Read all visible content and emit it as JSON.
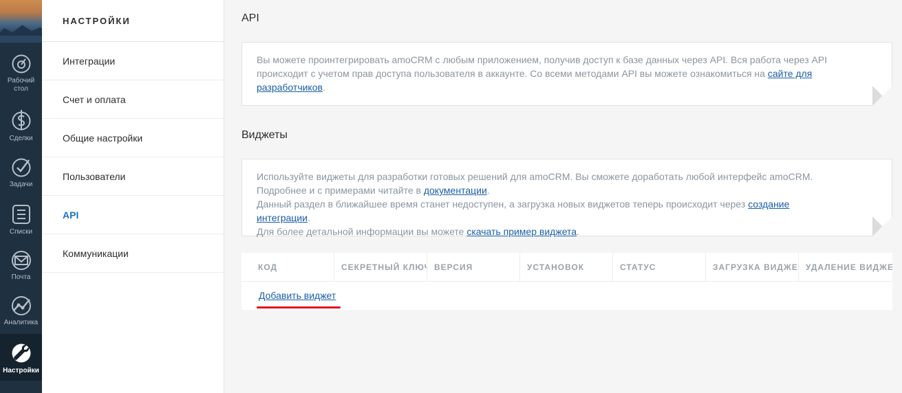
{
  "nav": {
    "items": [
      {
        "label": "Рабочий стол",
        "icon": "dashboard-icon"
      },
      {
        "label": "Сделки",
        "icon": "dollar-icon"
      },
      {
        "label": "Задачи",
        "icon": "check-icon"
      },
      {
        "label": "Списки",
        "icon": "list-icon"
      },
      {
        "label": "Почта",
        "icon": "mail-icon"
      },
      {
        "label": "Аналитика",
        "icon": "analytics-icon"
      },
      {
        "label": "Настройки",
        "icon": "wrench-icon"
      }
    ]
  },
  "sidebar": {
    "title": "НАСТРОЙКИ",
    "items": [
      {
        "label": "Интеграции"
      },
      {
        "label": "Счет и оплата"
      },
      {
        "label": "Общие настройки"
      },
      {
        "label": "Пользователи"
      },
      {
        "label": "API"
      },
      {
        "label": "Коммуникации"
      }
    ]
  },
  "api": {
    "title": "API",
    "text": "Вы можете проинтегрировать amoCRM с любым приложением, получив доступ к базе данных через API. Вся работа через API происходит с учетом прав доступа пользователя в аккаунте. Со всеми методами API вы можете ознакомиться на ",
    "link": "сайте для разработчиков",
    "tail": "."
  },
  "widgets": {
    "title": "Виджеты",
    "line1": "Используйте виджеты для разработки готовых решений для amoCRM. Вы сможете доработать любой интерфейс amoCRM. Подробнее и с примерами читайте в ",
    "line1_link": "документации",
    "line1_tail": ".",
    "line2": "Данный раздел в ближайшее время станет недоступен, а загрузка новых виджетов теперь происходит через ",
    "line2_link": "создание интеграции",
    "line2_tail": ".",
    "line3": "Для более детальной информации вы можете ",
    "line3_link": "скачать пример виджета",
    "line3_tail": "."
  },
  "table": {
    "columns": [
      "Код",
      "Секретный ключ",
      "Версия",
      "Установок",
      "Статус",
      "Загрузка виджета",
      "Удаление виджета"
    ],
    "add_label": "Добавить виджет"
  },
  "colors": {
    "nav_bg": "#1f3040",
    "accent": "#1a73c7",
    "link": "#1a5ea8",
    "highlight": "#e0141e"
  }
}
